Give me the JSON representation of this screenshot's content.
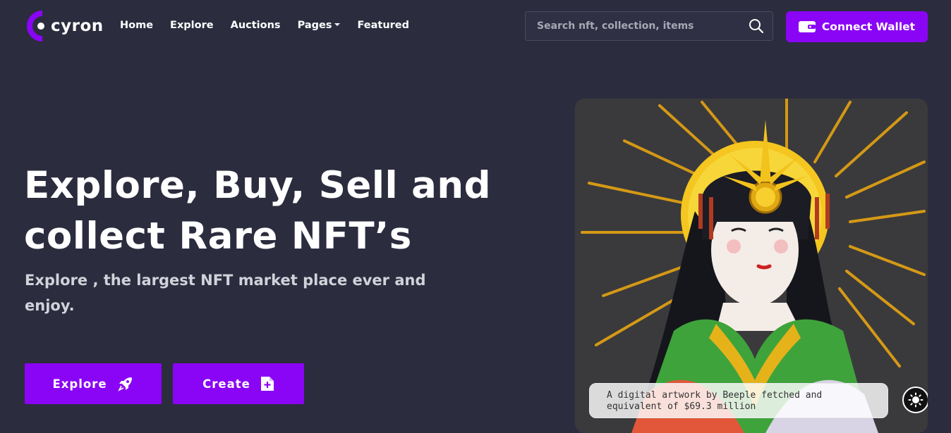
{
  "logo": {
    "text": "cyron"
  },
  "nav": {
    "items": [
      {
        "label": "Home"
      },
      {
        "label": "Explore"
      },
      {
        "label": "Auctions"
      },
      {
        "label": "Pages"
      },
      {
        "label": "Featured"
      }
    ]
  },
  "search": {
    "placeholder": "Search nft, collection, items",
    "value": ""
  },
  "wallet": {
    "label": "Connect Wallet"
  },
  "hero": {
    "title_line1": "Explore, Buy, Sell and",
    "title_line2": "collect Rare NFT’s",
    "subtitle_line1": "Explore , the largest NFT market place ever and",
    "subtitle_line2": "enjoy.",
    "explore_label": "Explore",
    "create_label": "Create"
  },
  "artwork": {
    "caption_line1": "A digital artwork by Beeple fetched and",
    "caption_line2": "equivalent of $69.3 million"
  },
  "colors": {
    "background": "#2b2c3e",
    "accent": "#8a05f5",
    "text": "#ffffff",
    "muted_text": "#d2d2da"
  },
  "icons": {
    "logo": "cyron-logo-icon",
    "search": "search-icon",
    "wallet": "wallet-icon",
    "explore": "rocket-icon",
    "create": "add-file-icon",
    "theme": "sun-icon",
    "dropdown": "chevron-down-icon"
  }
}
